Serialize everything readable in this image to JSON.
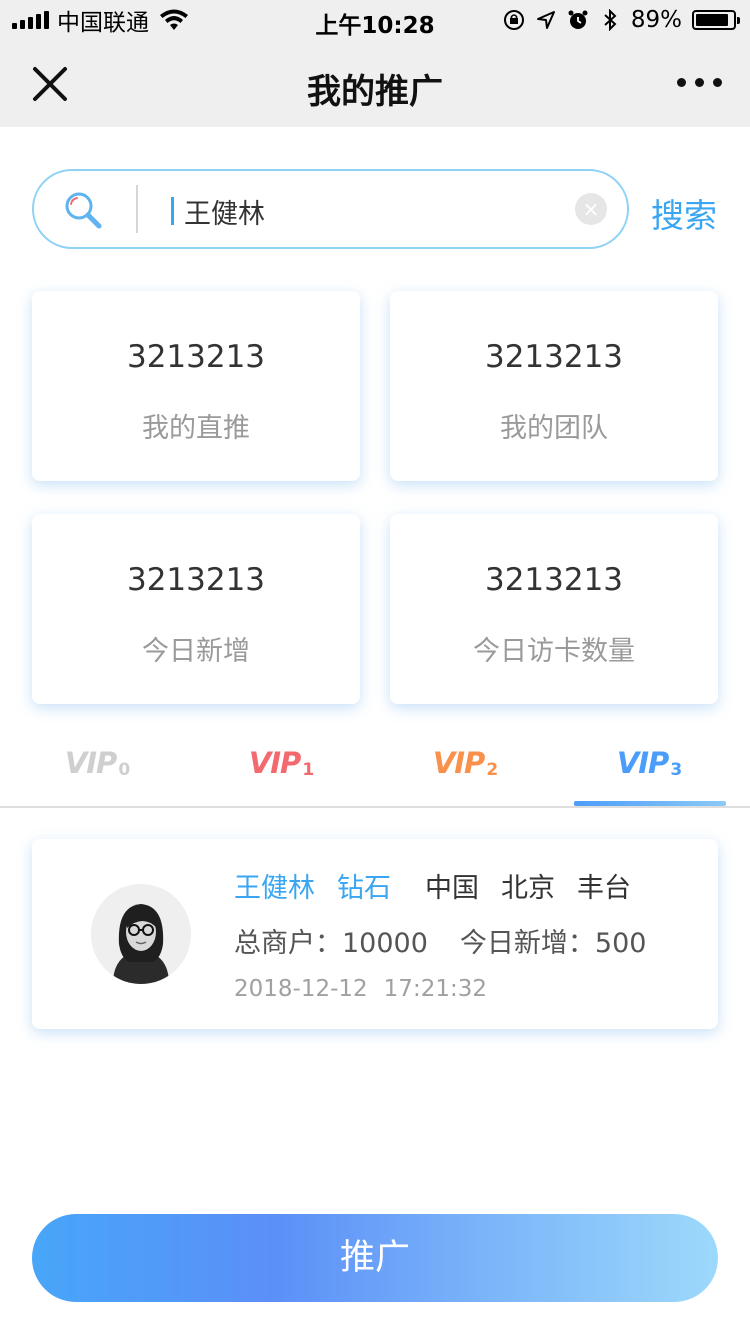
{
  "status_bar": {
    "carrier": "中国联通",
    "time": "上午10:28",
    "battery_percent": "89%",
    "battery_level": 0.89
  },
  "nav": {
    "title": "我的推广"
  },
  "search": {
    "value": "王健林",
    "button_label": "搜索",
    "clear_glyph": "×"
  },
  "stats": [
    {
      "value": "3213213",
      "label": "我的直推"
    },
    {
      "value": "3213213",
      "label": "我的团队"
    },
    {
      "value": "3213213",
      "label": "今日新增"
    },
    {
      "value": "3213213",
      "label": "今日访卡数量"
    }
  ],
  "tabs": [
    {
      "text": "VIP",
      "level": "0",
      "color": "#cfcfcf"
    },
    {
      "text": "VIP",
      "level": "1",
      "color": "#f26a6f"
    },
    {
      "text": "VIP",
      "level": "2",
      "color": "#f9904b"
    },
    {
      "text": "VIP",
      "level": "3",
      "color": "#4a9dfa"
    }
  ],
  "active_tab": 3,
  "member": {
    "name": "王健林",
    "level": "钻石",
    "country": "中国",
    "city": "北京",
    "district": "丰台",
    "merchants": "总商户：10000",
    "today_new": "今日新增：500",
    "date": "2018-12-12",
    "time": "17:21:32"
  },
  "promote_button": "推广",
  "colors": {
    "accent": "#3aa6f2",
    "nav_bg": "#efefef"
  }
}
